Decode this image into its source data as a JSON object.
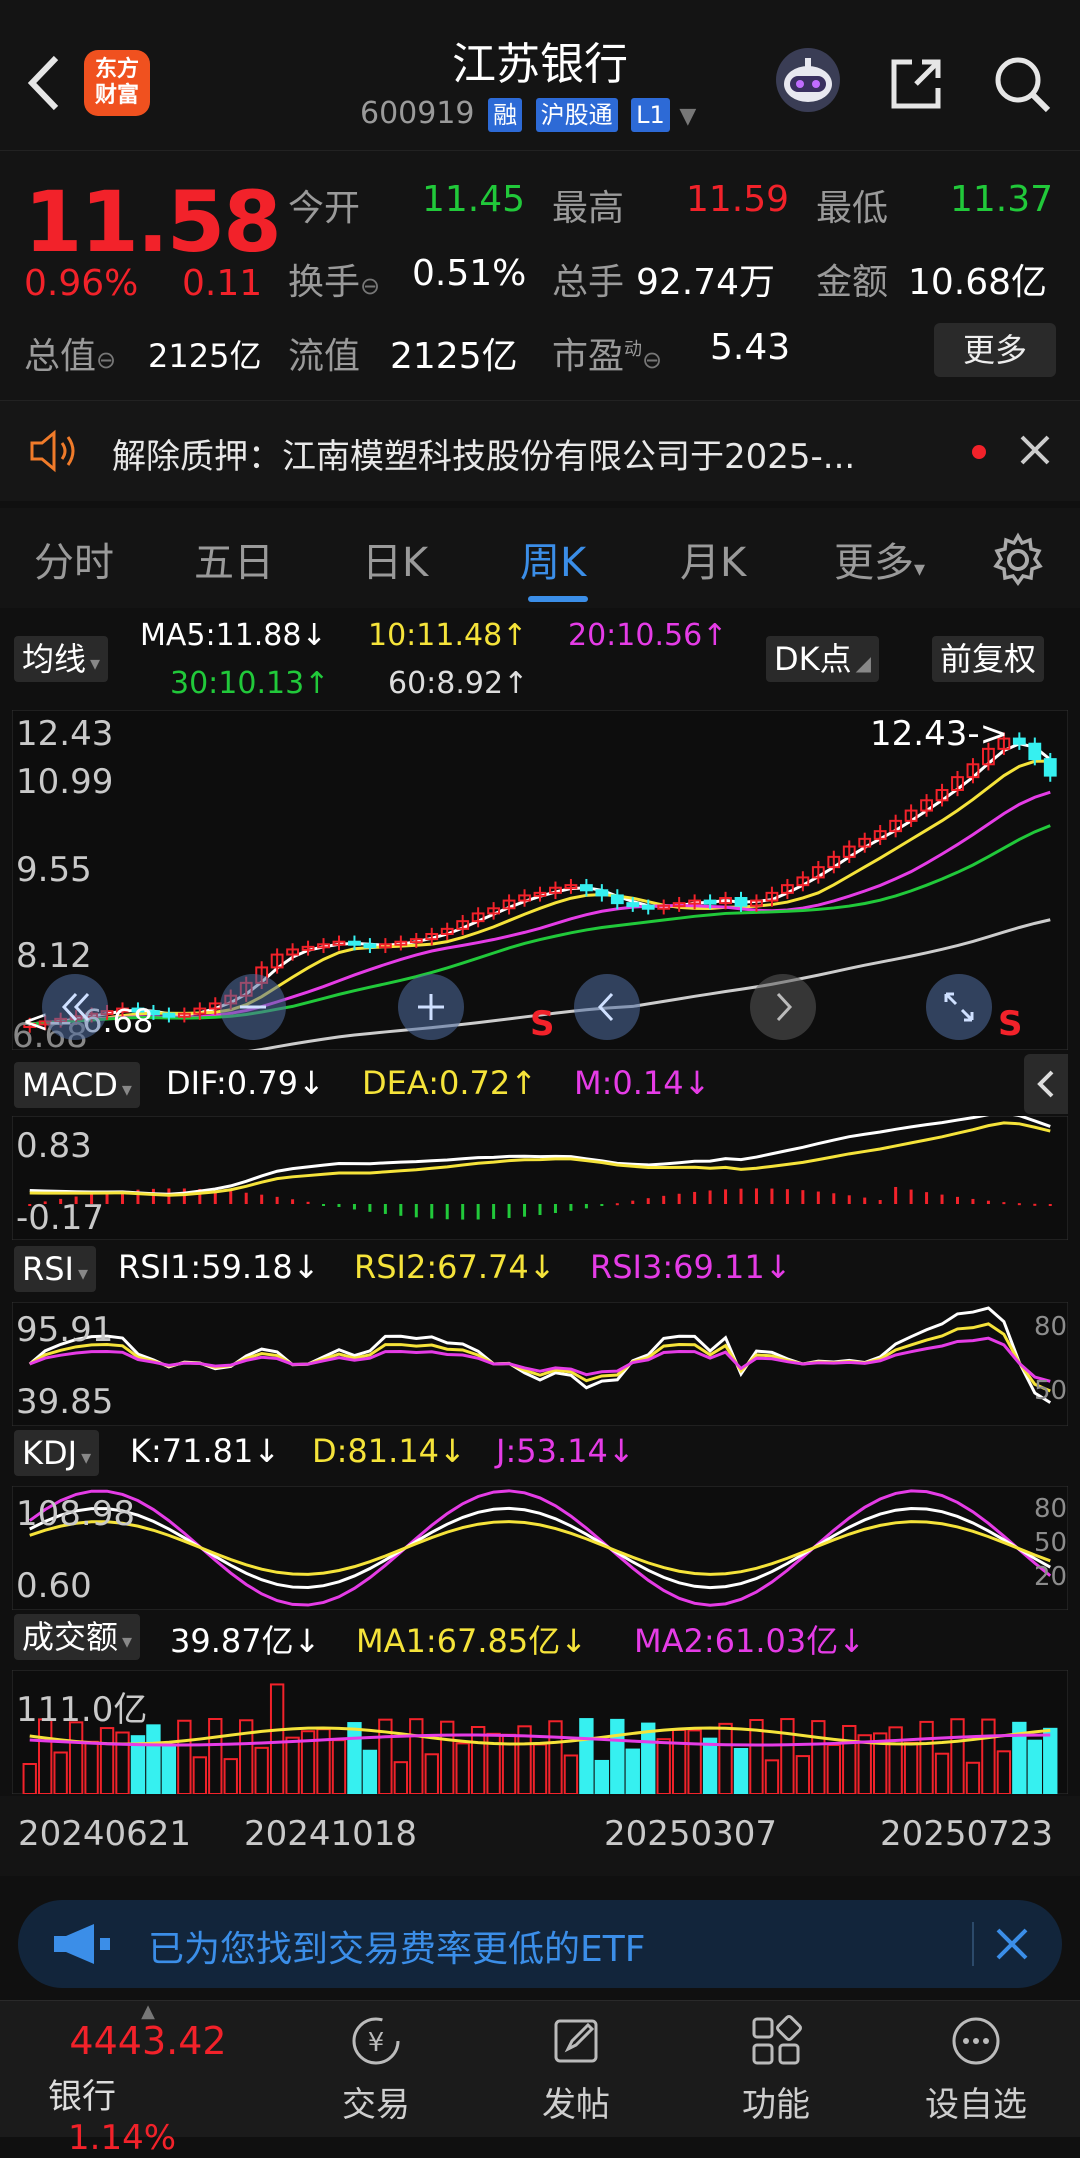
{
  "header": {
    "title": "江苏银行",
    "code": "600919",
    "tags": [
      "融",
      "沪股通",
      "L1"
    ],
    "logo_text_1": "东方",
    "logo_text_2": "财富"
  },
  "quote": {
    "price": "11.58",
    "change_pct": "0.96%",
    "change": "0.11",
    "open_label": "今开",
    "open": "11.45",
    "high_label": "最高",
    "high": "11.59",
    "low_label": "最低",
    "low": "11.37",
    "turnover_label": "换手",
    "turnover": "0.51%",
    "volume_label": "总手",
    "volume": "92.74万",
    "amount_label": "金额",
    "amount": "10.68亿",
    "mktcap_label": "总值",
    "mktcap": "2125亿",
    "float_label": "流值",
    "float": "2125亿",
    "pe_label": "市盈",
    "pe_sup": "动",
    "pe": "5.43",
    "more_label": "更多"
  },
  "news": {
    "text": "解除质押：江南模塑科技股份有限公司于2025-..."
  },
  "tabs": [
    "分时",
    "五日",
    "日K",
    "周K",
    "月K",
    "更多"
  ],
  "active_tab": "周K",
  "chart_controls": {
    "ma_select": "均线",
    "ma5": "MA5:11.88↓",
    "ma10": "10:11.48↑",
    "ma20": "20:10.56↑",
    "ma30": "30:10.13↑",
    "ma60": "60:8.92↑",
    "dk_button": "DK点",
    "fq_button": "前复权"
  },
  "chart_data": {
    "type": "candlestick",
    "price_axis": [
      "12.43",
      "10.99",
      "9.55",
      "8.12",
      "6.68"
    ],
    "max_label": "12.43->",
    "min_label": "<-- 6.68",
    "x_labels": [
      "20240621",
      "20241018",
      "20250307",
      "20250723"
    ],
    "sell_markers": [
      "S",
      "S"
    ],
    "closes": [
      6.75,
      6.8,
      6.85,
      6.9,
      6.95,
      7.0,
      7.05,
      7.0,
      6.95,
      6.9,
      6.95,
      7.05,
      7.15,
      7.3,
      7.55,
      7.85,
      8.1,
      8.2,
      8.25,
      8.3,
      8.35,
      8.3,
      8.25,
      8.3,
      8.35,
      8.4,
      8.5,
      8.6,
      8.75,
      8.9,
      9.0,
      9.15,
      9.25,
      9.3,
      9.4,
      9.45,
      9.35,
      9.25,
      9.1,
      9.05,
      9.0,
      9.05,
      9.1,
      9.15,
      9.1,
      9.2,
      9.05,
      9.15,
      9.3,
      9.45,
      9.6,
      9.8,
      10.0,
      10.2,
      10.35,
      10.5,
      10.7,
      10.9,
      11.1,
      11.3,
      11.55,
      11.8,
      12.1,
      12.3,
      12.2,
      11.9,
      11.58
    ],
    "ma_series": [
      {
        "name": "MA5",
        "color": "#ffffff"
      },
      {
        "name": "MA10",
        "color": "#f5e33a"
      },
      {
        "name": "MA20",
        "color": "#e53ce6"
      },
      {
        "name": "MA30",
        "color": "#21c93a"
      },
      {
        "name": "MA60",
        "color": "#cccccc"
      }
    ]
  },
  "macd": {
    "select": "MACD",
    "dif": "DIF:0.79↓",
    "dea": "DEA:0.72↑",
    "m": "M:0.14↓",
    "axis_top": "0.83",
    "axis_bottom": "-0.17"
  },
  "rsi": {
    "select": "RSI",
    "rsi1": "RSI1:59.18↓",
    "rsi2": "RSI2:67.74↓",
    "rsi3": "RSI3:69.11↓",
    "axis_top": "95.91",
    "axis_bottom": "39.85",
    "ref_80": "80",
    "ref_50": "50"
  },
  "kdj": {
    "select": "KDJ",
    "k": "K:71.81↓",
    "d": "D:81.14↓",
    "j": "J:53.14↓",
    "axis_top": "108.98",
    "axis_bottom": "0.60",
    "ref_80": "80",
    "ref_50": "50",
    "ref_20": "20"
  },
  "volume": {
    "select": "成交额",
    "value": "39.87亿↓",
    "ma1": "MA1:67.85亿↓",
    "ma2": "MA2:61.03亿↓",
    "axis_top": "111.0亿"
  },
  "ad": {
    "text": "已为您找到交易费率更低的ETF"
  },
  "bottom_nav": {
    "index_value": "4443.42",
    "index_name": "银行",
    "index_change": "1.14%",
    "items": [
      "交易",
      "发帖",
      "功能",
      "设自选"
    ]
  }
}
